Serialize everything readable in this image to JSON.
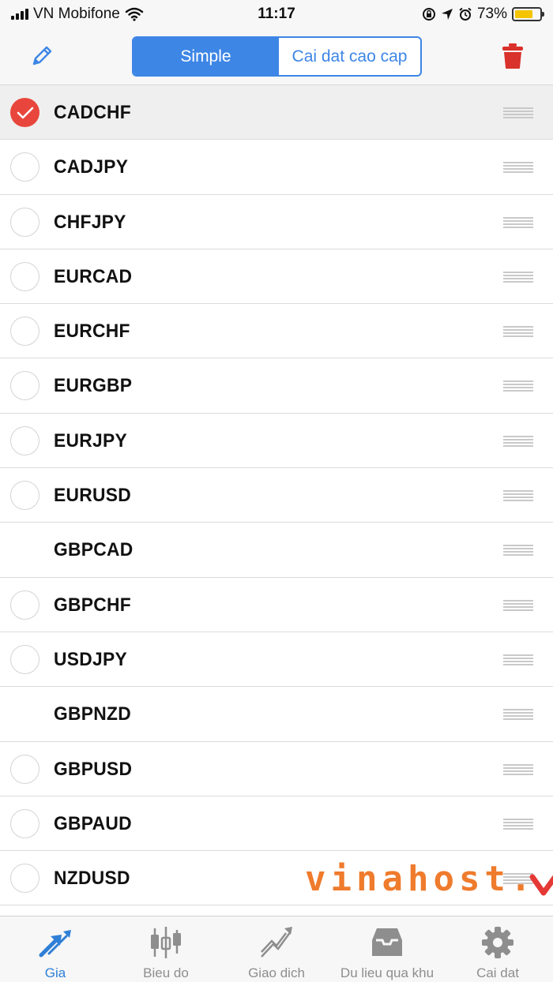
{
  "status_bar": {
    "carrier": "VN Mobifone",
    "time": "11:17",
    "battery": "73%",
    "battery_level": 0.73
  },
  "toolbar": {
    "edit_icon": "pencil-icon",
    "trash_icon": "trash-icon",
    "segments": [
      "Simple",
      "Cai dat cao cap"
    ],
    "selected_segment": "Simple"
  },
  "symbols": [
    {
      "name": "CADCHF",
      "selected": true,
      "radio": true
    },
    {
      "name": "CADJPY",
      "selected": false,
      "radio": true
    },
    {
      "name": "CHFJPY",
      "selected": false,
      "radio": true
    },
    {
      "name": "EURCAD",
      "selected": false,
      "radio": true
    },
    {
      "name": "EURCHF",
      "selected": false,
      "radio": true
    },
    {
      "name": "EURGBP",
      "selected": false,
      "radio": true
    },
    {
      "name": "EURJPY",
      "selected": false,
      "radio": true
    },
    {
      "name": "EURUSD",
      "selected": false,
      "radio": true
    },
    {
      "name": "GBPCAD",
      "selected": false,
      "radio": false
    },
    {
      "name": "GBPCHF",
      "selected": false,
      "radio": true
    },
    {
      "name": "USDJPY",
      "selected": false,
      "radio": true
    },
    {
      "name": "GBPNZD",
      "selected": false,
      "radio": false
    },
    {
      "name": "GBPUSD",
      "selected": false,
      "radio": true
    },
    {
      "name": "GBPAUD",
      "selected": false,
      "radio": true
    },
    {
      "name": "NZDUSD",
      "selected": false,
      "radio": true
    }
  ],
  "watermark": {
    "text": "vinahost."
  },
  "tabs": [
    {
      "label": "Gia",
      "icon": "quotes-arrows-icon",
      "active": true
    },
    {
      "label": "Bieu do",
      "icon": "candlestick-chart-icon",
      "active": false
    },
    {
      "label": "Giao dich",
      "icon": "trade-trend-icon",
      "active": false
    },
    {
      "label": "Du lieu qua khu",
      "icon": "history-inbox-icon",
      "active": false
    },
    {
      "label": "Cai dat",
      "icon": "gear-icon",
      "active": false
    }
  ],
  "colors": {
    "accent": "#3d86e6",
    "check": "#e8463c",
    "trash": "#d9312b",
    "watermark": "#ef7b2d",
    "watermark_check": "#e53935"
  }
}
